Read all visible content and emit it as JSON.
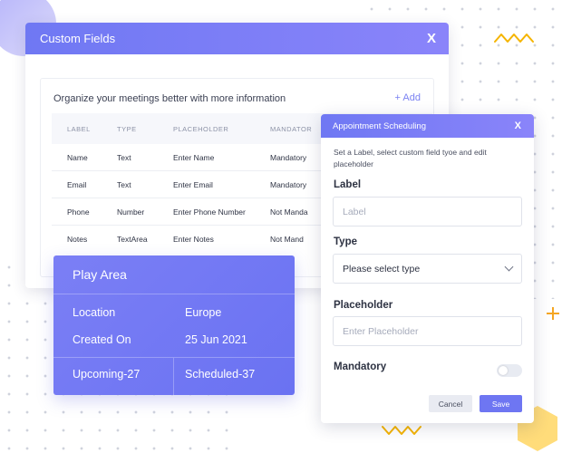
{
  "custom_fields": {
    "title": "Custom Fields",
    "close": "X",
    "subtitle": "Organize your meetings better with more information",
    "add_label": "+ Add",
    "columns": [
      "LABEL",
      "TYPE",
      "PLACEHOLDER",
      "MANDATOR"
    ],
    "rows": [
      {
        "label": "Name",
        "type": "Text",
        "placeholder": "Enter Name",
        "mandatory": "Mandatory"
      },
      {
        "label": "Email",
        "type": "Text",
        "placeholder": "Enter Email",
        "mandatory": "Mandatory"
      },
      {
        "label": "Phone",
        "type": "Number",
        "placeholder": "Enter Phone Number",
        "mandatory": "Not Manda"
      },
      {
        "label": "Notes",
        "type": "TextArea",
        "placeholder": "Enter Notes",
        "mandatory": "Not Mand"
      }
    ]
  },
  "play_area": {
    "title": "Play Area",
    "location_label": "Location",
    "location_value": "Europe",
    "created_label": "Created On",
    "created_value": "25 Jun 2021",
    "upcoming": "Upcoming-27",
    "scheduled": "Scheduled-37"
  },
  "appointment": {
    "title": "Appointment Scheduling",
    "close": "X",
    "description": "Set a Label, select custom field tyoe and edit placeholder",
    "label_heading": "Label",
    "label_placeholder": "Label",
    "type_heading": "Type",
    "type_value": "Please select type",
    "placeholder_heading": "Placeholder",
    "placeholder_placeholder": "Enter Placeholder",
    "mandatory_heading": "Mandatory",
    "mandatory_on": false,
    "cancel": "Cancel",
    "save": "Save"
  },
  "colors": {
    "accent": "#6f78f3",
    "zigzag": "#f5b400",
    "plus": "#f5a623",
    "hexagon": "#ffd86b"
  }
}
